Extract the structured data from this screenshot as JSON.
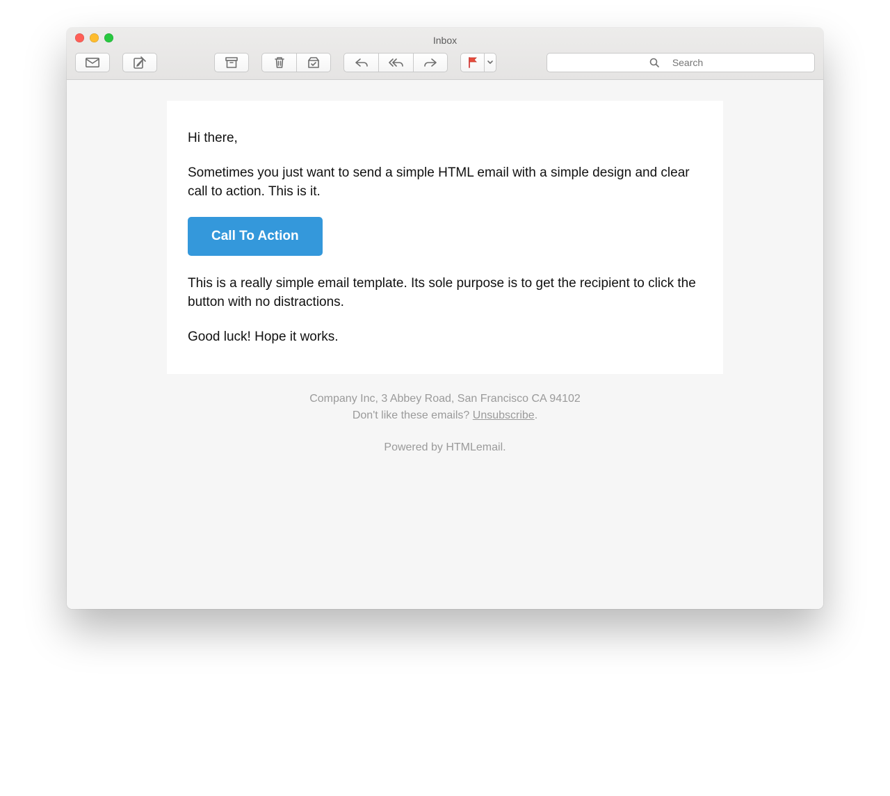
{
  "window": {
    "title": "Inbox"
  },
  "search": {
    "placeholder": "Search"
  },
  "email": {
    "greeting": "Hi there,",
    "intro": "Sometimes you just want to send a simple HTML email with a simple design and clear call to action. This is it.",
    "cta_label": "Call To Action",
    "body2": "This is a really simple email template. Its sole purpose is to get the recipient to click the button with no distractions.",
    "closing": "Good luck! Hope it works."
  },
  "footer": {
    "address": "Company Inc, 3 Abbey Road, San Francisco CA 94102",
    "unsub_prefix": "Don't like these emails? ",
    "unsub_link": "Unsubscribe",
    "unsub_suffix": ".",
    "powered": "Powered by HTMLemail."
  }
}
